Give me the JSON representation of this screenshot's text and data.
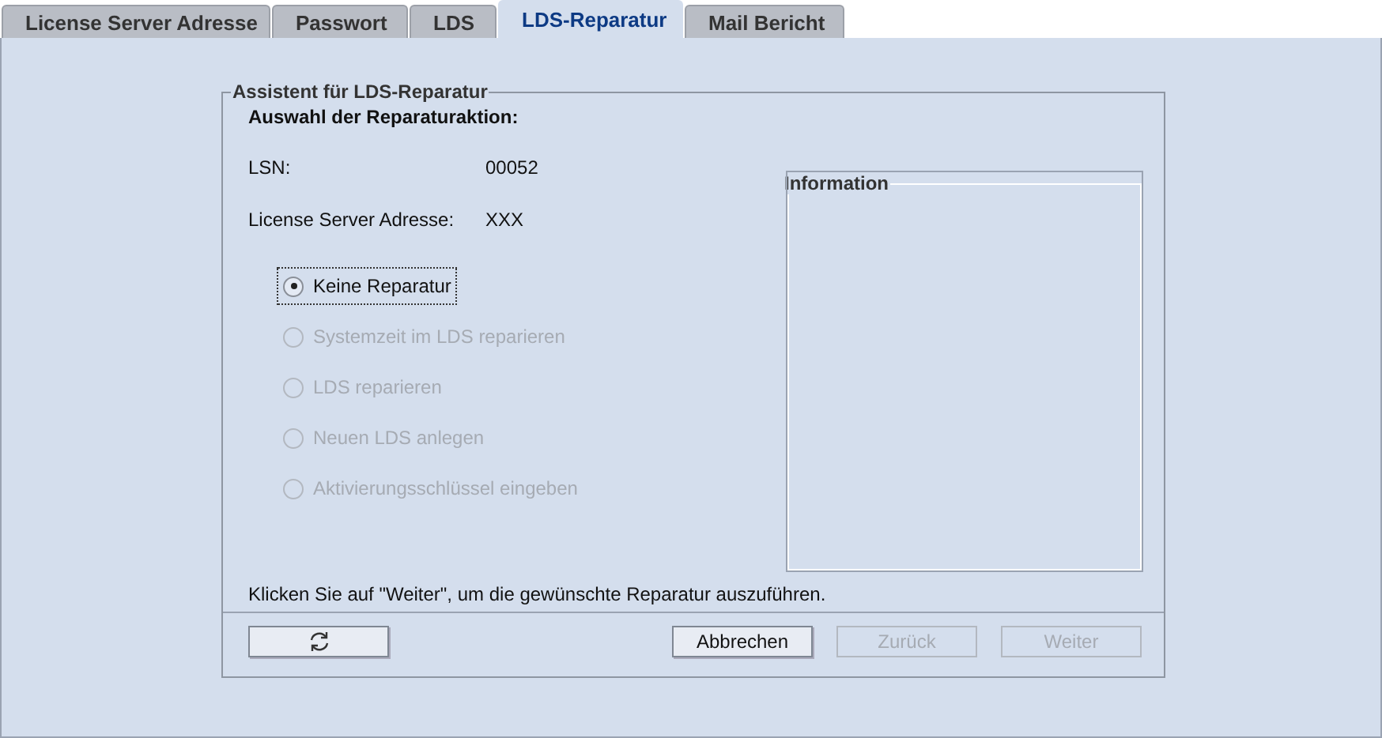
{
  "tabs": [
    {
      "label": "License Server Adresse",
      "selected": false
    },
    {
      "label": "Passwort",
      "selected": false
    },
    {
      "label": "LDS",
      "selected": false
    },
    {
      "label": "LDS-Reparatur",
      "selected": true
    },
    {
      "label": "Mail Bericht",
      "selected": false
    }
  ],
  "wizard": {
    "title": "Assistent für LDS-Reparatur",
    "heading": "Auswahl der Reparaturaktion:",
    "fields": [
      {
        "label": "LSN:",
        "value": "00052"
      },
      {
        "label": "License Server Adresse:",
        "value": "XXX"
      }
    ],
    "options": [
      {
        "label": "Keine Reparatur",
        "selected": true,
        "disabled": false
      },
      {
        "label": "Systemzeit im LDS reparieren",
        "selected": false,
        "disabled": true
      },
      {
        "label": "LDS reparieren",
        "selected": false,
        "disabled": true
      },
      {
        "label": "Neuen LDS anlegen",
        "selected": false,
        "disabled": true
      },
      {
        "label": "Aktivierungsschlüssel eingeben",
        "selected": false,
        "disabled": true
      }
    ],
    "information": {
      "title": "Information"
    },
    "hint": "Klicken Sie auf \"Weiter\", um die gewünschte Reparatur auszuführen.",
    "buttons": [
      {
        "kind": "icon",
        "disabled": false
      },
      {
        "kind": "text",
        "label": "Abbrechen",
        "disabled": false
      },
      {
        "kind": "text",
        "label": "Zurück",
        "disabled": true
      },
      {
        "kind": "text",
        "label": "Weiter",
        "disabled": true
      }
    ]
  }
}
